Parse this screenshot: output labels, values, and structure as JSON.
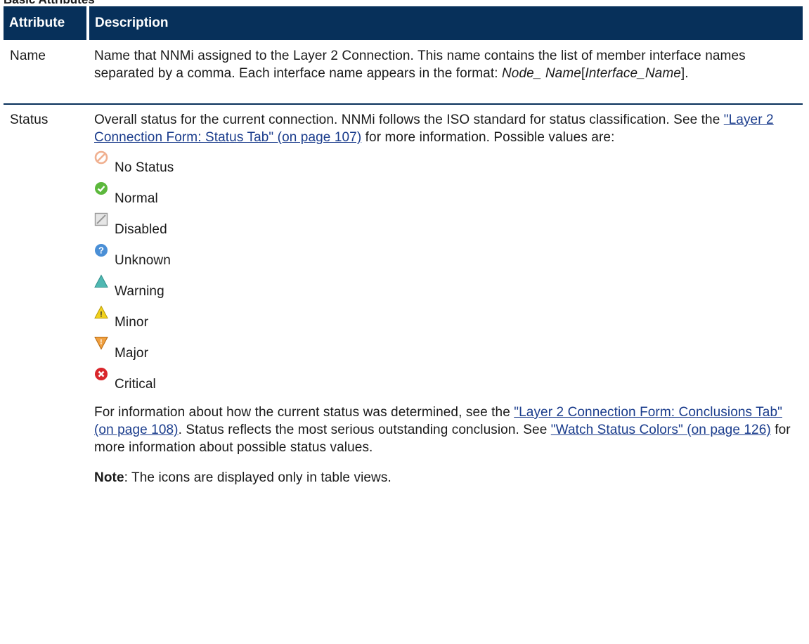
{
  "section": {
    "title": "Basic Attributes"
  },
  "table": {
    "headers": {
      "attribute": "Attribute",
      "description": "Description"
    },
    "name_row": {
      "attribute": "Name",
      "text_1": "Name that NNMi assigned to the Layer 2 Connection. This name contains the list of member interface names separated by a comma. Each interface name appears in the format: ",
      "node_name": "Node_ Name",
      "bracket_open": "[",
      "interface_name": "Interface_Name",
      "bracket_close": "]."
    },
    "status_row": {
      "attribute": "Status",
      "intro_1": "Overall status for the current connection. NNMi follows the ISO standard for status classification. See the ",
      "intro_link": "\"Layer 2 Connection Form: Status Tab\" (on page 107)",
      "intro_2": " for more information. Possible values are:",
      "values": [
        {
          "label": "No Status",
          "icon": "no-status-icon"
        },
        {
          "label": "Normal",
          "icon": "normal-icon"
        },
        {
          "label": "Disabled",
          "icon": "disabled-icon"
        },
        {
          "label": "Unknown",
          "icon": "unknown-icon"
        },
        {
          "label": "Warning",
          "icon": "warning-icon"
        },
        {
          "label": "Minor",
          "icon": "minor-icon"
        },
        {
          "label": "Major",
          "icon": "major-icon"
        },
        {
          "label": "Critical",
          "icon": "critical-icon"
        }
      ],
      "after_1": "For information about how the current status was determined, see the ",
      "after_link_1": "\"Layer 2 Connection Form: Conclusions Tab\" (on page 108)",
      "after_2": ". Status reflects the most serious outstanding conclusion. See ",
      "after_link_2": "\"Watch Status Colors\" (on page 126)",
      "after_3": " for more information about possible status values.",
      "note_label": "Note",
      "note_text": ": The icons are displayed only in table views."
    }
  },
  "colors": {
    "header_bg": "#07305a",
    "link": "#1a3c8c"
  }
}
